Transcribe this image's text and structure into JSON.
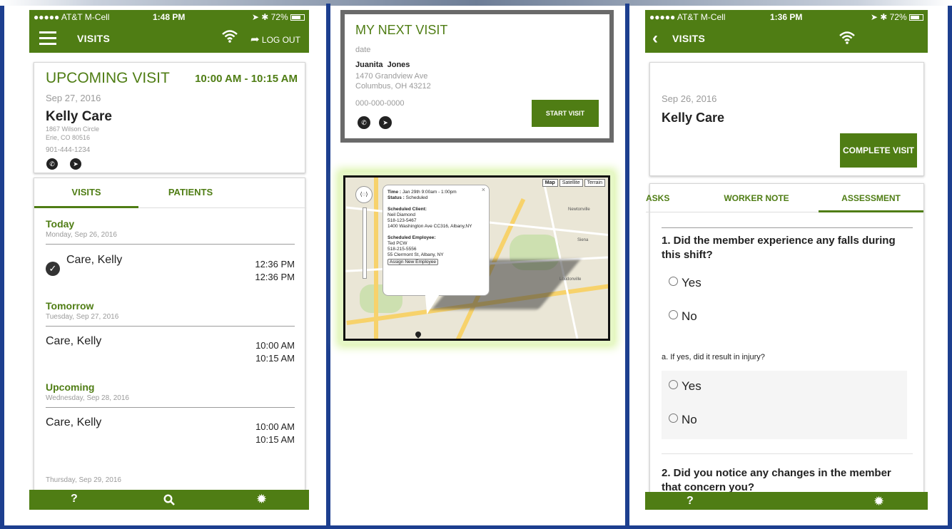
{
  "colors": {
    "accent": "#4f7d14",
    "frame": "#1d3f8f"
  },
  "left": {
    "status": {
      "carrier": "●●●●● AT&T M-Cell",
      "time": "1:48 PM",
      "battery": "72%"
    },
    "nav": {
      "title": "VISITS",
      "logout": "LOG OUT"
    },
    "upcoming": {
      "heading": "UPCOMING VISIT",
      "time_range": "10:00 AM - 10:15 AM",
      "date": "Sep 27, 2016",
      "name": "Kelly Care",
      "address1": "1867 Wilson Circle",
      "address2": "Erie, CO 80516",
      "phone": "901-444-1234"
    },
    "tabs": {
      "visits": "VISITS",
      "patients": "PATIENTS"
    },
    "sections": [
      {
        "title": "Today",
        "sub": "Monday, Sep 26, 2016",
        "name": "Care, Kelly",
        "t1": "12:36 PM",
        "t2": "12:36 PM"
      },
      {
        "title": "Tomorrow",
        "sub": "Tuesday, Sep 27, 2016",
        "name": "Care, Kelly",
        "t1": "10:00 AM",
        "t2": "10:15 AM"
      },
      {
        "title": "Upcoming",
        "sub": "Wednesday, Sep 28, 2016",
        "name": "Care, Kelly",
        "t1": "10:00 AM",
        "t2": "10:15 AM"
      }
    ],
    "trailing_date": "Thursday, Sep 29, 2016",
    "bottom": {
      "help": "?",
      "search_icon": "search-icon",
      "settings_icon": "gear-icon"
    }
  },
  "middle": {
    "next_visit": {
      "heading": "MY NEXT VISIT",
      "date": "date",
      "name": "Juanita  Jones",
      "address1": "1470 Grandview Ave",
      "address2": "Columbus, OH 43212",
      "phone": "000-000-0000",
      "start_button": "START VISIT"
    },
    "map": {
      "buttons": [
        "Map",
        "Satellite",
        "Terrain"
      ],
      "popup": {
        "time_label": "Time :",
        "time_value": "Jan 29th 9:00am - 1:00pm",
        "status_label": "Status :",
        "status_value": "Scheduled",
        "client_label": "Scheduled Client:",
        "client_name": "Neil Diamond",
        "client_phone": "518-123-5467",
        "client_address": "1400 Washington Ave CC316, Albany,NY",
        "employee_label": "Scheduled Employee:",
        "employee_name": "Ted PCW",
        "employee_phone": "518-215-5556",
        "employee_address": "55 Clermont St, Albany, NY",
        "assign_button": "Assign New Employee",
        "close": "×"
      },
      "places": [
        "Newtonville",
        "Siena",
        "Loudonville"
      ]
    }
  },
  "right": {
    "status": {
      "carrier": "●●●●● AT&T M-Cell",
      "time": "1:36 PM",
      "battery": "72%"
    },
    "nav": {
      "title": "VISITS"
    },
    "visit": {
      "date": "Sep 26, 2016",
      "name": "Kelly Care",
      "complete_button": "COMPLETE VISIT"
    },
    "tabs": {
      "tasks": "ASKS",
      "worker_note": "WORKER NOTE",
      "assessment": "ASSESSMENT"
    },
    "q1": {
      "text": "1. Did the member experience any falls during this shift?",
      "yes": "Yes",
      "no": "No"
    },
    "q1a": {
      "text": "a. If yes, did it result in injury?",
      "yes": "Yes",
      "no": "No"
    },
    "q2": {
      "text": "2. Did you notice any changes in the member that concern you?"
    },
    "bottom": {
      "help": "?",
      "settings_icon": "gear-icon"
    }
  }
}
